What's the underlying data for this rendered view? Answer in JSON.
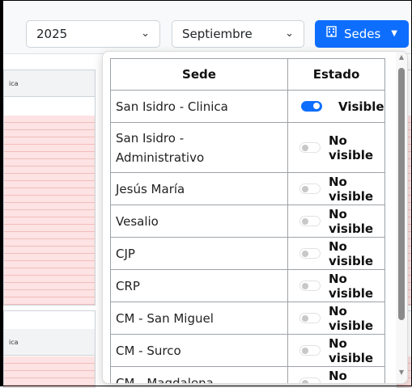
{
  "filters": {
    "year": "2025",
    "month": "Septiembre",
    "sedes_button": "Sedes",
    "chevron": "⌄",
    "caret": "▼"
  },
  "background": {
    "panel_label": "ica"
  },
  "sedes_table": {
    "headers": {
      "sede": "Sede",
      "estado": "Estado"
    },
    "rows": [
      {
        "sede": "San Isidro - Clinica",
        "estado": "Visible",
        "on": true
      },
      {
        "sede": "San Isidro - Administrativo",
        "estado": "No visible",
        "on": false
      },
      {
        "sede": "Jesús María",
        "estado": "No visible",
        "on": false
      },
      {
        "sede": "Vesalio",
        "estado": "No visible",
        "on": false
      },
      {
        "sede": "CJP",
        "estado": "No visible",
        "on": false
      },
      {
        "sede": "CRP",
        "estado": "No visible",
        "on": false
      },
      {
        "sede": "CM - San Miguel",
        "estado": "No visible",
        "on": false
      },
      {
        "sede": "CM - Surco",
        "estado": "No visible",
        "on": false
      },
      {
        "sede": "CM - Magdalena",
        "estado": "No visible",
        "on": false
      }
    ]
  },
  "colors": {
    "primary": "#0d6efd",
    "row_pink": "#fde3e3"
  },
  "icons": {
    "building": "building-icon",
    "chevron": "chevron-down-icon"
  }
}
